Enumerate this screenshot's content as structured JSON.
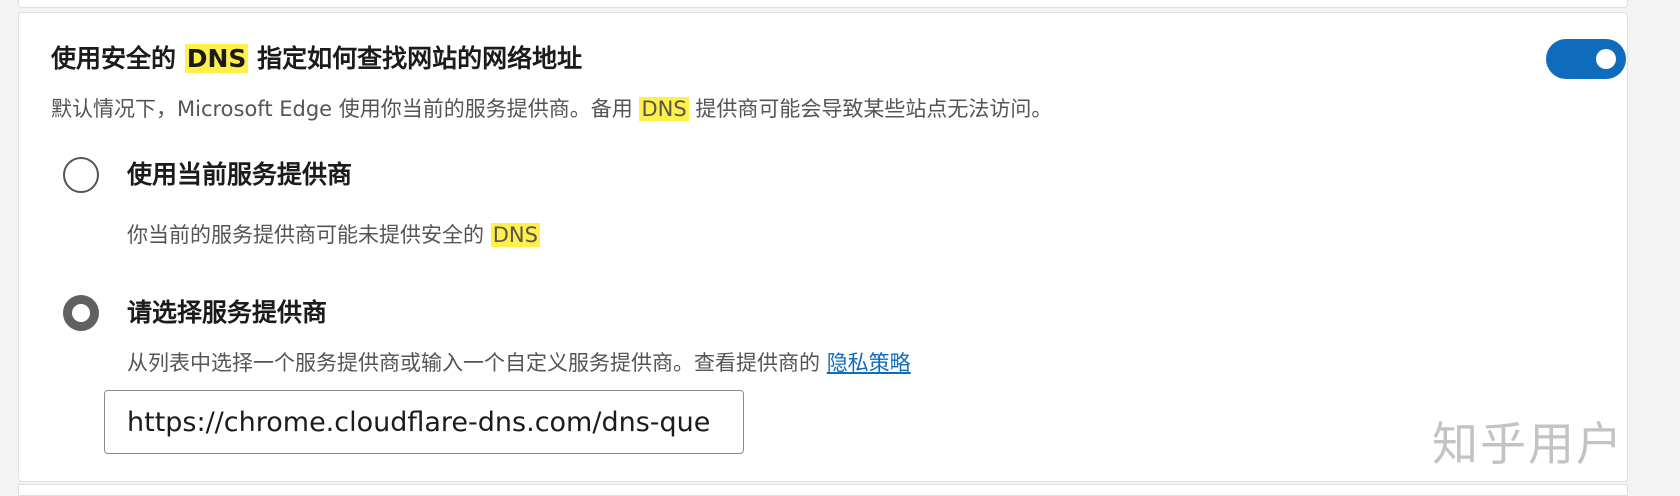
{
  "section": {
    "title_prefix": "使用安全的",
    "title_highlight": "DNS",
    "title_suffix": "指定如何查找网站的网络地址",
    "description_prefix": "默认情况下，Microsoft Edge 使用你当前的服务提供商。备用",
    "description_highlight": "DNS",
    "description_suffix": "提供商可能会导致某些站点无法访问。",
    "toggle_on": true
  },
  "options": [
    {
      "label": "使用当前服务提供商",
      "desc_prefix": "你当前的服务提供商可能未提供安全的",
      "desc_highlight": "DNS",
      "selected": false
    },
    {
      "label": "请选择服务提供商",
      "desc_prefix": "从列表中选择一个服务提供商或输入一个自定义服务提供商。查看提供商的",
      "desc_link": "隐私策略",
      "selected": true
    }
  ],
  "provider_input": {
    "value": "https://chrome.cloudflare-dns.com/dns-que"
  },
  "watermark": "知乎用户",
  "colors": {
    "accent": "#0f6cbd",
    "highlight": "#fff04a",
    "radio_selected": "#616161"
  }
}
